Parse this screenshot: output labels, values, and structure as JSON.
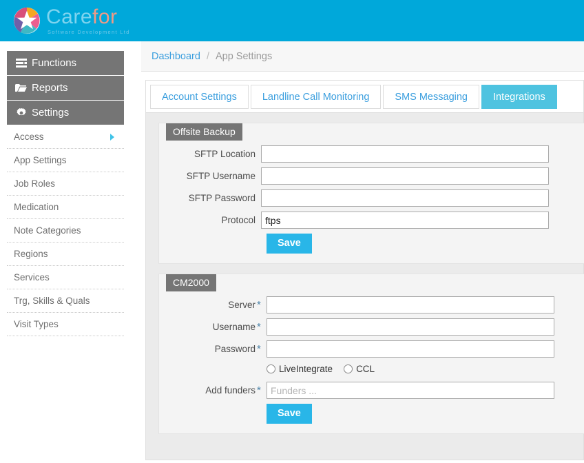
{
  "brand": {
    "name_part1": "Care",
    "name_part2": "for",
    "tagline": "Software Development Ltd",
    "logo_icon": "pinwheel-logo-icon"
  },
  "sidebar": {
    "main_items": [
      {
        "label": "Functions",
        "icon": "list-stack-icon"
      },
      {
        "label": "Reports",
        "icon": "open-folder-icon"
      },
      {
        "label": "Settings",
        "icon": "gear-icon"
      }
    ],
    "sub_items": [
      {
        "label": "Access",
        "has_caret": true
      },
      {
        "label": "App Settings",
        "has_caret": false
      },
      {
        "label": "Job Roles",
        "has_caret": false
      },
      {
        "label": "Medication",
        "has_caret": false
      },
      {
        "label": "Note Categories",
        "has_caret": false
      },
      {
        "label": "Regions",
        "has_caret": false
      },
      {
        "label": "Services",
        "has_caret": false
      },
      {
        "label": "Trg, Skills & Quals",
        "has_caret": false
      },
      {
        "label": "Visit Types",
        "has_caret": false
      }
    ]
  },
  "breadcrumb": {
    "root": "Dashboard",
    "separator": "/",
    "current": "App Settings"
  },
  "tabs": [
    {
      "label": "Account Settings",
      "active": false
    },
    {
      "label": "Landline Call Monitoring",
      "active": false
    },
    {
      "label": "SMS Messaging",
      "active": false
    },
    {
      "label": "Integrations",
      "active": true
    }
  ],
  "offsite_backup": {
    "title": "Offsite Backup",
    "fields": [
      {
        "label": "SFTP Location",
        "value": "",
        "placeholder": "",
        "required": false
      },
      {
        "label": "SFTP Username",
        "value": "",
        "placeholder": "",
        "required": false
      },
      {
        "label": "SFTP Password",
        "value": "",
        "placeholder": "",
        "required": false
      },
      {
        "label": "Protocol",
        "value": "ftps",
        "placeholder": "",
        "required": false
      }
    ],
    "save_label": "Save"
  },
  "cm2000": {
    "title": "CM2000",
    "fields": [
      {
        "label": "Server",
        "value": "",
        "placeholder": "",
        "required": true
      },
      {
        "label": "Username",
        "value": "",
        "placeholder": "",
        "required": true
      },
      {
        "label": "Password",
        "value": "",
        "placeholder": "",
        "required": true
      }
    ],
    "radios": [
      {
        "label": "LiveIntegrate",
        "checked": false
      },
      {
        "label": "CCL",
        "checked": false
      }
    ],
    "funders_field": {
      "label": "Add funders",
      "value": "",
      "placeholder": "Funders ...",
      "required": true
    },
    "save_label": "Save"
  },
  "colors": {
    "brand_bar": "#00a8da",
    "accent_cyan": "#29b6e8",
    "tab_active": "#4ec3e0",
    "link_blue": "#3a9ede",
    "section_header_gray": "#757575",
    "panel_bg": "#ebebeb",
    "required_star": "#4a82a8"
  },
  "required_marker": "*"
}
